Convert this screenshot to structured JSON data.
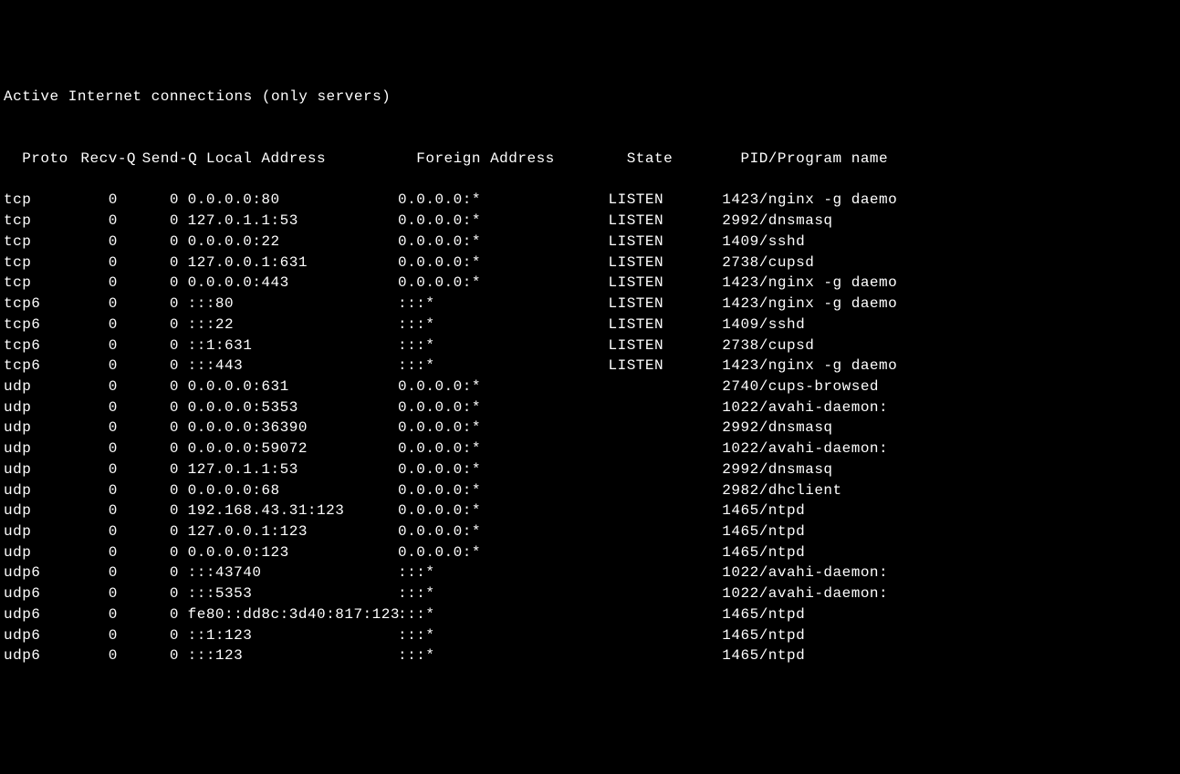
{
  "title": "Active Internet connections (only servers)",
  "headers": {
    "proto": "Proto",
    "recvq": "Recv-Q",
    "sendq": "Send-Q",
    "local": "Local Address",
    "foreign": "Foreign Address",
    "state": "State",
    "program": "PID/Program name"
  },
  "rows": [
    {
      "proto": "tcp",
      "recvq": "0",
      "sendq": "0",
      "local": "0.0.0.0:80",
      "foreign": "0.0.0.0:*",
      "state": "LISTEN",
      "program": "1423/nginx -g daemo"
    },
    {
      "proto": "tcp",
      "recvq": "0",
      "sendq": "0",
      "local": "127.0.1.1:53",
      "foreign": "0.0.0.0:*",
      "state": "LISTEN",
      "program": "2992/dnsmasq"
    },
    {
      "proto": "tcp",
      "recvq": "0",
      "sendq": "0",
      "local": "0.0.0.0:22",
      "foreign": "0.0.0.0:*",
      "state": "LISTEN",
      "program": "1409/sshd"
    },
    {
      "proto": "tcp",
      "recvq": "0",
      "sendq": "0",
      "local": "127.0.0.1:631",
      "foreign": "0.0.0.0:*",
      "state": "LISTEN",
      "program": "2738/cupsd"
    },
    {
      "proto": "tcp",
      "recvq": "0",
      "sendq": "0",
      "local": "0.0.0.0:443",
      "foreign": "0.0.0.0:*",
      "state": "LISTEN",
      "program": "1423/nginx -g daemo"
    },
    {
      "proto": "tcp6",
      "recvq": "0",
      "sendq": "0",
      "local": ":::80",
      "foreign": ":::*",
      "state": "LISTEN",
      "program": "1423/nginx -g daemo"
    },
    {
      "proto": "tcp6",
      "recvq": "0",
      "sendq": "0",
      "local": ":::22",
      "foreign": ":::*",
      "state": "LISTEN",
      "program": "1409/sshd"
    },
    {
      "proto": "tcp6",
      "recvq": "0",
      "sendq": "0",
      "local": "::1:631",
      "foreign": ":::*",
      "state": "LISTEN",
      "program": "2738/cupsd"
    },
    {
      "proto": "tcp6",
      "recvq": "0",
      "sendq": "0",
      "local": ":::443",
      "foreign": ":::*",
      "state": "LISTEN",
      "program": "1423/nginx -g daemo"
    },
    {
      "proto": "udp",
      "recvq": "0",
      "sendq": "0",
      "local": "0.0.0.0:631",
      "foreign": "0.0.0.0:*",
      "state": "",
      "program": "2740/cups-browsed"
    },
    {
      "proto": "udp",
      "recvq": "0",
      "sendq": "0",
      "local": "0.0.0.0:5353",
      "foreign": "0.0.0.0:*",
      "state": "",
      "program": "1022/avahi-daemon:"
    },
    {
      "proto": "udp",
      "recvq": "0",
      "sendq": "0",
      "local": "0.0.0.0:36390",
      "foreign": "0.0.0.0:*",
      "state": "",
      "program": "2992/dnsmasq"
    },
    {
      "proto": "udp",
      "recvq": "0",
      "sendq": "0",
      "local": "0.0.0.0:59072",
      "foreign": "0.0.0.0:*",
      "state": "",
      "program": "1022/avahi-daemon:"
    },
    {
      "proto": "udp",
      "recvq": "0",
      "sendq": "0",
      "local": "127.0.1.1:53",
      "foreign": "0.0.0.0:*",
      "state": "",
      "program": "2992/dnsmasq"
    },
    {
      "proto": "udp",
      "recvq": "0",
      "sendq": "0",
      "local": "0.0.0.0:68",
      "foreign": "0.0.0.0:*",
      "state": "",
      "program": "2982/dhclient"
    },
    {
      "proto": "udp",
      "recvq": "0",
      "sendq": "0",
      "local": "192.168.43.31:123",
      "foreign": "0.0.0.0:*",
      "state": "",
      "program": "1465/ntpd"
    },
    {
      "proto": "udp",
      "recvq": "0",
      "sendq": "0",
      "local": "127.0.0.1:123",
      "foreign": "0.0.0.0:*",
      "state": "",
      "program": "1465/ntpd"
    },
    {
      "proto": "udp",
      "recvq": "0",
      "sendq": "0",
      "local": "0.0.0.0:123",
      "foreign": "0.0.0.0:*",
      "state": "",
      "program": "1465/ntpd"
    },
    {
      "proto": "udp6",
      "recvq": "0",
      "sendq": "0",
      "local": ":::43740",
      "foreign": ":::*",
      "state": "",
      "program": "1022/avahi-daemon:"
    },
    {
      "proto": "udp6",
      "recvq": "0",
      "sendq": "0",
      "local": ":::5353",
      "foreign": ":::*",
      "state": "",
      "program": "1022/avahi-daemon:"
    },
    {
      "proto": "udp6",
      "recvq": "0",
      "sendq": "0",
      "local": "fe80::dd8c:3d40:817:123",
      "foreign": ":::*",
      "state": "",
      "program": "1465/ntpd"
    },
    {
      "proto": "udp6",
      "recvq": "0",
      "sendq": "0",
      "local": "::1:123",
      "foreign": ":::*",
      "state": "",
      "program": "1465/ntpd"
    },
    {
      "proto": "udp6",
      "recvq": "0",
      "sendq": "0",
      "local": ":::123",
      "foreign": ":::*",
      "state": "",
      "program": "1465/ntpd"
    }
  ]
}
